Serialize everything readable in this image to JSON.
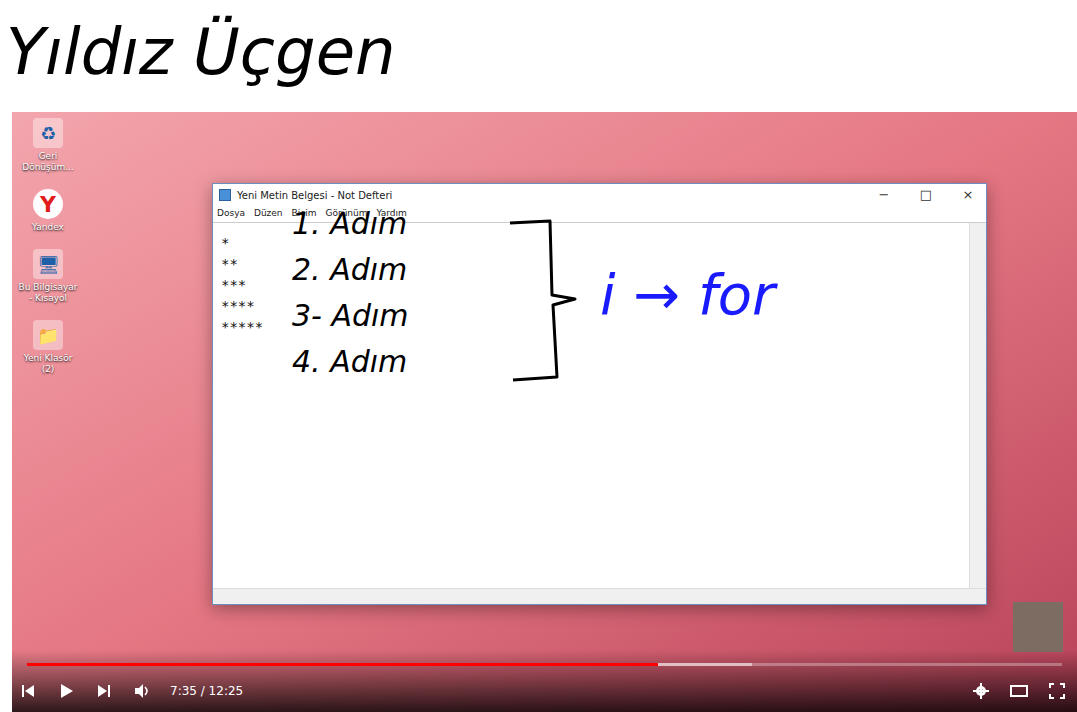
{
  "annotations": [
    {
      "text": "Yıldız Üçgen",
      "color": "#000000"
    },
    {
      "text": "1. Adım",
      "color": "#000000"
    },
    {
      "text": "2. Adım",
      "color": "#000000"
    },
    {
      "text": "3- Adım",
      "color": "#000000"
    },
    {
      "text": "4. Adım",
      "color": "#000000"
    },
    {
      "text": "i → for",
      "color": "#1a1aff"
    }
  ],
  "desktop_icons": [
    {
      "label": "Geri Dönüşüm...",
      "glyph": "♻"
    },
    {
      "label": "Yandex",
      "glyph": "Y"
    },
    {
      "label": "Bu Bilgisayar - Kısayol",
      "glyph": "🖥"
    },
    {
      "label": "Yeni Klasör (2)",
      "glyph": "📁"
    }
  ],
  "notepad": {
    "title": "Yeni Metin Belgesi - Not Defteri",
    "menu": [
      "Dosya",
      "Düzen",
      "Biçim",
      "Görünüm",
      "Yardım"
    ],
    "lines": [
      "*",
      "**",
      "***",
      "****",
      "*****"
    ],
    "controls": [
      "−",
      "□",
      "×"
    ]
  },
  "player": {
    "time": "7:35 / 12:25",
    "level": 0.61,
    "buffered": 0.7
  }
}
